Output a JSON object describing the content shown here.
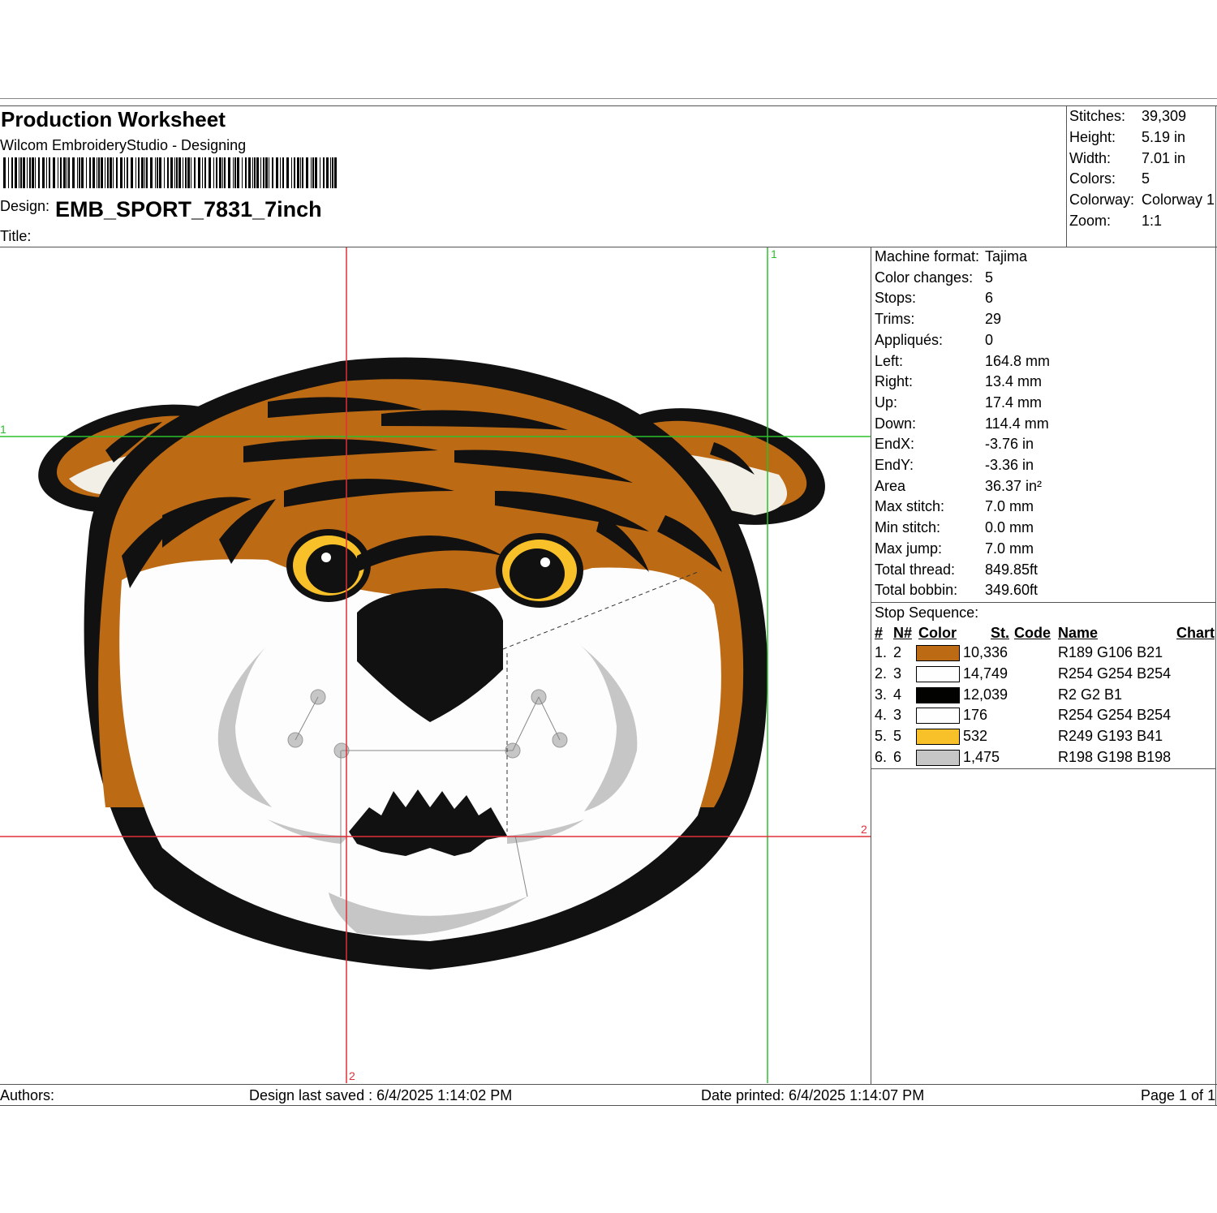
{
  "header": {
    "title": "Production Worksheet",
    "software": "Wilcom EmbroideryStudio - Designing",
    "design_label": "Design:",
    "design_name": "EMB_SPORT_7831_7inch",
    "title_label": "Title:"
  },
  "summary": [
    {
      "label": "Stitches:",
      "value": "39,309"
    },
    {
      "label": "Height:",
      "value": "5.19 in"
    },
    {
      "label": "Width:",
      "value": "7.01 in"
    },
    {
      "label": "Colors:",
      "value": "5"
    },
    {
      "label": "Colorway:",
      "value": "Colorway 1"
    },
    {
      "label": "Zoom:",
      "value": "1:1"
    }
  ],
  "machine_stats": [
    {
      "label": "Machine format:",
      "value": "Tajima"
    },
    {
      "label": "Color changes:",
      "value": "5"
    },
    {
      "label": "Stops:",
      "value": "6"
    },
    {
      "label": "Trims:",
      "value": "29"
    },
    {
      "label": "Appliqués:",
      "value": "0"
    },
    {
      "label": "Left:",
      "value": "164.8 mm"
    },
    {
      "label": "Right:",
      "value": "13.4 mm"
    },
    {
      "label": "Up:",
      "value": "17.4 mm"
    },
    {
      "label": "Down:",
      "value": "114.4 mm"
    },
    {
      "label": "EndX:",
      "value": "-3.76 in"
    },
    {
      "label": "EndY:",
      "value": "-3.36 in"
    },
    {
      "label": "Area",
      "value": " 36.37 in²"
    },
    {
      "label": "Max stitch:",
      "value": "7.0 mm"
    },
    {
      "label": "Min stitch:",
      "value": "0.0 mm"
    },
    {
      "label": "Max jump:",
      "value": "7.0 mm"
    },
    {
      "label": "Total thread:",
      "value": "849.85ft"
    },
    {
      "label": "Total bobbin:",
      "value": "349.60ft"
    }
  ],
  "stop_sequence": {
    "title": "Stop Sequence:",
    "headers": {
      "num": "#",
      "needle": "N#",
      "color": "Color",
      "stitches": "St.",
      "code": "Code",
      "name": "Name",
      "chart": "Chart"
    },
    "rows": [
      {
        "num": "1.",
        "needle": "2",
        "color": "#BD6A15",
        "stitches": "10,336",
        "name": "R189 G106 B21"
      },
      {
        "num": "2.",
        "needle": "3",
        "color": "#FEFEFE",
        "stitches": "14,749",
        "name": "R254 G254 B254"
      },
      {
        "num": "3.",
        "needle": "4",
        "color": "#020201",
        "stitches": "12,039",
        "name": "R2 G2 B1"
      },
      {
        "num": "4.",
        "needle": "3",
        "color": "#FEFEFE",
        "stitches": "176",
        "name": "R254 G254 B254"
      },
      {
        "num": "5.",
        "needle": "5",
        "color": "#F9C129",
        "stitches": "532",
        "name": "R249 G193 B41"
      },
      {
        "num": "6.",
        "needle": "6",
        "color": "#C6C6C6",
        "stitches": "1,475",
        "name": "R198 G198 B198"
      }
    ]
  },
  "canvas": {
    "guide_label_green": "1",
    "guide_label_red": "2"
  },
  "footer": {
    "authors": "Authors:",
    "saved": "Design last saved : 6/4/2025 1:14:02 PM",
    "printed": "Date printed: 6/4/2025 1:14:07 PM",
    "page": "Page 1 of 1"
  },
  "colors": {
    "orange": "#BD6A15",
    "black": "#020201",
    "white": "#FEFEFE",
    "yellow": "#F9C129",
    "gray": "#C6C6C6",
    "guide_red": "#E0303A",
    "guide_green": "#2BC02B"
  }
}
